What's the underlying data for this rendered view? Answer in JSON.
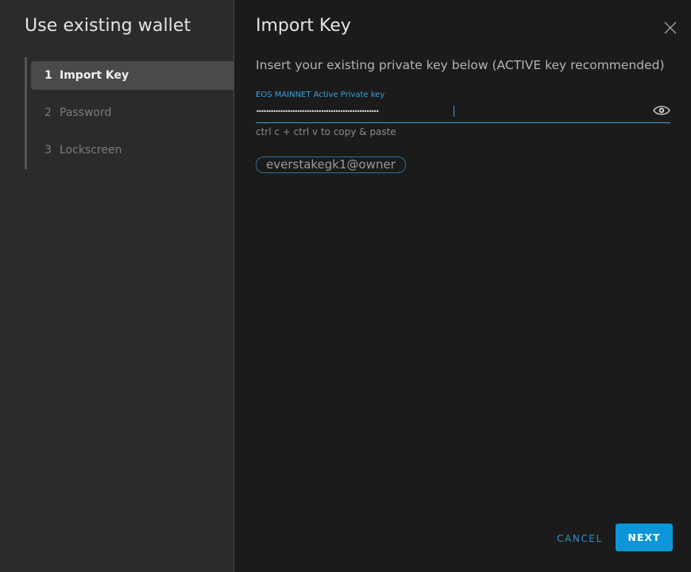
{
  "sidebar": {
    "title": "Use existing wallet",
    "steps": [
      {
        "number": "1",
        "label": "Import Key",
        "active": true
      },
      {
        "number": "2",
        "label": "Password",
        "active": false
      },
      {
        "number": "3",
        "label": "Lockscreen",
        "active": false
      }
    ]
  },
  "main": {
    "title": "Import Key",
    "instruction": "Insert your existing private key below (ACTIVE key recommended)",
    "key_field": {
      "label": "EOS MAINNET Active Private key",
      "masked_value": "•••••••••••••••••••••••••••••••••••••••••••••••••••",
      "hint": "ctrl c + ctrl v to copy & paste"
    },
    "account": "everstakegk1@owner"
  },
  "actions": {
    "cancel_label": "CANCEL",
    "next_label": "NEXT"
  },
  "icons": {
    "close": "close-icon",
    "eye": "eye-icon"
  },
  "colors": {
    "accent": "#0a96d9",
    "label_blue": "#3aa0e0",
    "sidebar_bg": "#2b2b2b",
    "main_bg": "#1b1b1b"
  }
}
